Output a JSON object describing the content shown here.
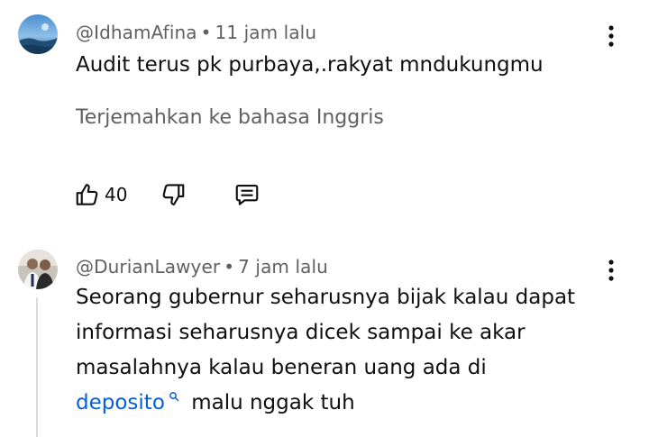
{
  "comment1": {
    "author": "@IdhamAfina",
    "separator": "•",
    "time": "11 jam lalu",
    "text": "Audit terus pk purbaya,.rakyat mndukungmu",
    "translate_label": "Terjemahkan ke bahasa Inggris",
    "like_count": "40"
  },
  "comment2": {
    "author": "@DurianLawyer",
    "separator": "•",
    "time": "7 jam lalu",
    "line1": "Seorang gubernur seharusnya bijak kalau dapat",
    "line2": "informasi seharusnya dicek sampai ke akar",
    "line3": "masalahnya kalau beneran uang ada di",
    "link_text": "deposito",
    "line4_rest": "malu nggak tuh"
  },
  "colors": {
    "text": "#0f0f0f",
    "secondary": "#606060",
    "link": "#065fd4",
    "thread_line": "#dcdcdc"
  },
  "icons": [
    "kebab-menu-icon",
    "thumbs-up-icon",
    "thumbs-down-icon",
    "reply-icon",
    "search-suggestion-icon"
  ]
}
